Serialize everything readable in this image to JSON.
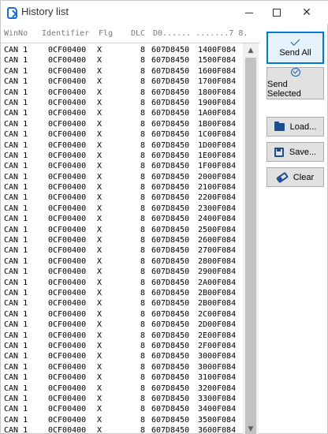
{
  "window": {
    "title": "History list"
  },
  "header": {
    "winno": "WinNo",
    "identifier": "Identifier",
    "flg": "Flg",
    "dlc": "DLC",
    "data": "D0...... .......7 8."
  },
  "rows": [
    {
      "win": "CAN 1",
      "id": "0CF00400",
      "flg": "X",
      "dlc": "8",
      "d0": "607D8450",
      "d4": "1400F084"
    },
    {
      "win": "CAN 1",
      "id": "0CF00400",
      "flg": "X",
      "dlc": "8",
      "d0": "607D8450",
      "d4": "1500F084"
    },
    {
      "win": "CAN 1",
      "id": "0CF00400",
      "flg": "X",
      "dlc": "8",
      "d0": "607D8450",
      "d4": "1600F084"
    },
    {
      "win": "CAN 1",
      "id": "0CF00400",
      "flg": "X",
      "dlc": "8",
      "d0": "607D8450",
      "d4": "1700F084"
    },
    {
      "win": "CAN 1",
      "id": "0CF00400",
      "flg": "X",
      "dlc": "8",
      "d0": "607D8450",
      "d4": "1800F084"
    },
    {
      "win": "CAN 1",
      "id": "0CF00400",
      "flg": "X",
      "dlc": "8",
      "d0": "607D8450",
      "d4": "1900F084"
    },
    {
      "win": "CAN 1",
      "id": "0CF00400",
      "flg": "X",
      "dlc": "8",
      "d0": "607D8450",
      "d4": "1A00F084"
    },
    {
      "win": "CAN 1",
      "id": "0CF00400",
      "flg": "X",
      "dlc": "8",
      "d0": "607D8450",
      "d4": "1B00F084"
    },
    {
      "win": "CAN 1",
      "id": "0CF00400",
      "flg": "X",
      "dlc": "8",
      "d0": "607D8450",
      "d4": "1C00F084"
    },
    {
      "win": "CAN 1",
      "id": "0CF00400",
      "flg": "X",
      "dlc": "8",
      "d0": "607D8450",
      "d4": "1D00F084"
    },
    {
      "win": "CAN 1",
      "id": "0CF00400",
      "flg": "X",
      "dlc": "8",
      "d0": "607D8450",
      "d4": "1E00F084"
    },
    {
      "win": "CAN 1",
      "id": "0CF00400",
      "flg": "X",
      "dlc": "8",
      "d0": "607D8450",
      "d4": "1F00F084"
    },
    {
      "win": "CAN 1",
      "id": "0CF00400",
      "flg": "X",
      "dlc": "8",
      "d0": "607D8450",
      "d4": "2000F084"
    },
    {
      "win": "CAN 1",
      "id": "0CF00400",
      "flg": "X",
      "dlc": "8",
      "d0": "607D8450",
      "d4": "2100F084"
    },
    {
      "win": "CAN 1",
      "id": "0CF00400",
      "flg": "X",
      "dlc": "8",
      "d0": "607D8450",
      "d4": "2200F084"
    },
    {
      "win": "CAN 1",
      "id": "0CF00400",
      "flg": "X",
      "dlc": "8",
      "d0": "607D8450",
      "d4": "2300F084"
    },
    {
      "win": "CAN 1",
      "id": "0CF00400",
      "flg": "X",
      "dlc": "8",
      "d0": "607D8450",
      "d4": "2400F084"
    },
    {
      "win": "CAN 1",
      "id": "0CF00400",
      "flg": "X",
      "dlc": "8",
      "d0": "607D8450",
      "d4": "2500F084"
    },
    {
      "win": "CAN 1",
      "id": "0CF00400",
      "flg": "X",
      "dlc": "8",
      "d0": "607D8450",
      "d4": "2600F084"
    },
    {
      "win": "CAN 1",
      "id": "0CF00400",
      "flg": "X",
      "dlc": "8",
      "d0": "607D8450",
      "d4": "2700F084"
    },
    {
      "win": "CAN 1",
      "id": "0CF00400",
      "flg": "X",
      "dlc": "8",
      "d0": "607D8450",
      "d4": "2800F084"
    },
    {
      "win": "CAN 1",
      "id": "0CF00400",
      "flg": "X",
      "dlc": "8",
      "d0": "607D8450",
      "d4": "2900F084"
    },
    {
      "win": "CAN 1",
      "id": "0CF00400",
      "flg": "X",
      "dlc": "8",
      "d0": "607D8450",
      "d4": "2A00F084"
    },
    {
      "win": "CAN 1",
      "id": "0CF00400",
      "flg": "X",
      "dlc": "8",
      "d0": "607D8450",
      "d4": "2B00F084"
    },
    {
      "win": "CAN 1",
      "id": "0CF00400",
      "flg": "X",
      "dlc": "8",
      "d0": "607D8450",
      "d4": "2B00F084"
    },
    {
      "win": "CAN 1",
      "id": "0CF00400",
      "flg": "X",
      "dlc": "8",
      "d0": "607D8450",
      "d4": "2C00F084"
    },
    {
      "win": "CAN 1",
      "id": "0CF00400",
      "flg": "X",
      "dlc": "8",
      "d0": "607D8450",
      "d4": "2D00F084"
    },
    {
      "win": "CAN 1",
      "id": "0CF00400",
      "flg": "X",
      "dlc": "8",
      "d0": "607D8450",
      "d4": "2E00F084"
    },
    {
      "win": "CAN 1",
      "id": "0CF00400",
      "flg": "X",
      "dlc": "8",
      "d0": "607D8450",
      "d4": "2F00F084"
    },
    {
      "win": "CAN 1",
      "id": "0CF00400",
      "flg": "X",
      "dlc": "8",
      "d0": "607D8450",
      "d4": "3000F084"
    },
    {
      "win": "CAN 1",
      "id": "0CF00400",
      "flg": "X",
      "dlc": "8",
      "d0": "607D8450",
      "d4": "3000F084"
    },
    {
      "win": "CAN 1",
      "id": "0CF00400",
      "flg": "X",
      "dlc": "8",
      "d0": "607D8450",
      "d4": "3100F084"
    },
    {
      "win": "CAN 1",
      "id": "0CF00400",
      "flg": "X",
      "dlc": "8",
      "d0": "607D8450",
      "d4": "3200F084"
    },
    {
      "win": "CAN 1",
      "id": "0CF00400",
      "flg": "X",
      "dlc": "8",
      "d0": "607D8450",
      "d4": "3300F084"
    },
    {
      "win": "CAN 1",
      "id": "0CF00400",
      "flg": "X",
      "dlc": "8",
      "d0": "607D8450",
      "d4": "3400F084"
    },
    {
      "win": "CAN 1",
      "id": "0CF00400",
      "flg": "X",
      "dlc": "8",
      "d0": "607D8450",
      "d4": "3500F084"
    },
    {
      "win": "CAN 1",
      "id": "0CF00400",
      "flg": "X",
      "dlc": "8",
      "d0": "607D8450",
      "d4": "3600F084"
    }
  ],
  "buttons": {
    "send_all": "Send All",
    "send_selected": "Send Selected",
    "load": "Load...",
    "save": "Save...",
    "clear": "Clear"
  },
  "icons": {
    "app": "history-list-icon",
    "send_all": "check-icon",
    "send_selected": "check-circle-icon",
    "load": "folder-icon",
    "save": "floppy-disk-icon",
    "clear": "eraser-icon"
  },
  "colors": {
    "accent": "#0078d7",
    "icon_blue": "#1a4f8f"
  }
}
